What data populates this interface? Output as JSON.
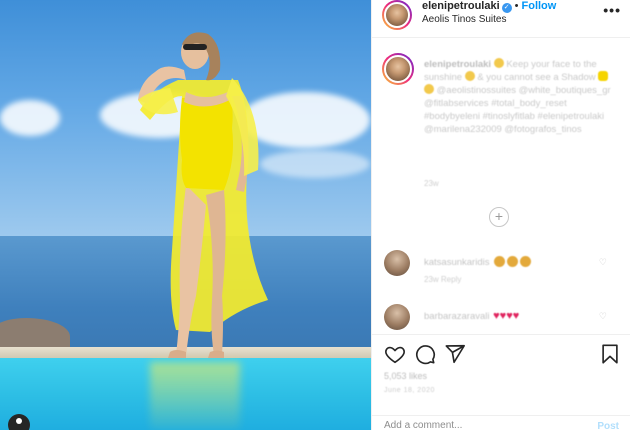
{
  "header": {
    "username": "elenipetroulaki",
    "follow_label": "Follow",
    "separator": "•",
    "location": "Aeolis Tinos Suites",
    "more_label": "•••"
  },
  "caption": {
    "username": "elenipetroulaki",
    "text_1": "Keep your face to the sunshine",
    "text_2": "& you cannot see a Shadow",
    "tags": "@aeolistinossuites @white_boutiques_gr @fitlabservices #total_body_reset #bodybyeleni #tinoslyfitlab #elenipetroulaki @marilena232009 @fotografos_tinos",
    "time": "23w",
    "load_more": "+"
  },
  "comments": [
    {
      "username": "katsasunkaridis",
      "meta": "23w  Reply",
      "hearts": ""
    },
    {
      "username": "barbarazaravali",
      "meta": "",
      "hearts": "♥♥♥♥"
    }
  ],
  "actions": {
    "likes": "5,053 likes",
    "date": "June 18, 2020",
    "comment_placeholder": "Add a comment...",
    "post_label": "Post"
  },
  "icons": {
    "like": "heart-outline-icon",
    "comment": "comment-bubble-icon",
    "share": "paper-plane-icon",
    "save": "bookmark-icon",
    "user_tag": "user-tag-icon"
  },
  "colors": {
    "follow_blue": "#0095f6",
    "swimsuit_yellow": "#f3e300",
    "pool": "#2ebfe5",
    "sky": "#64a9e6"
  }
}
